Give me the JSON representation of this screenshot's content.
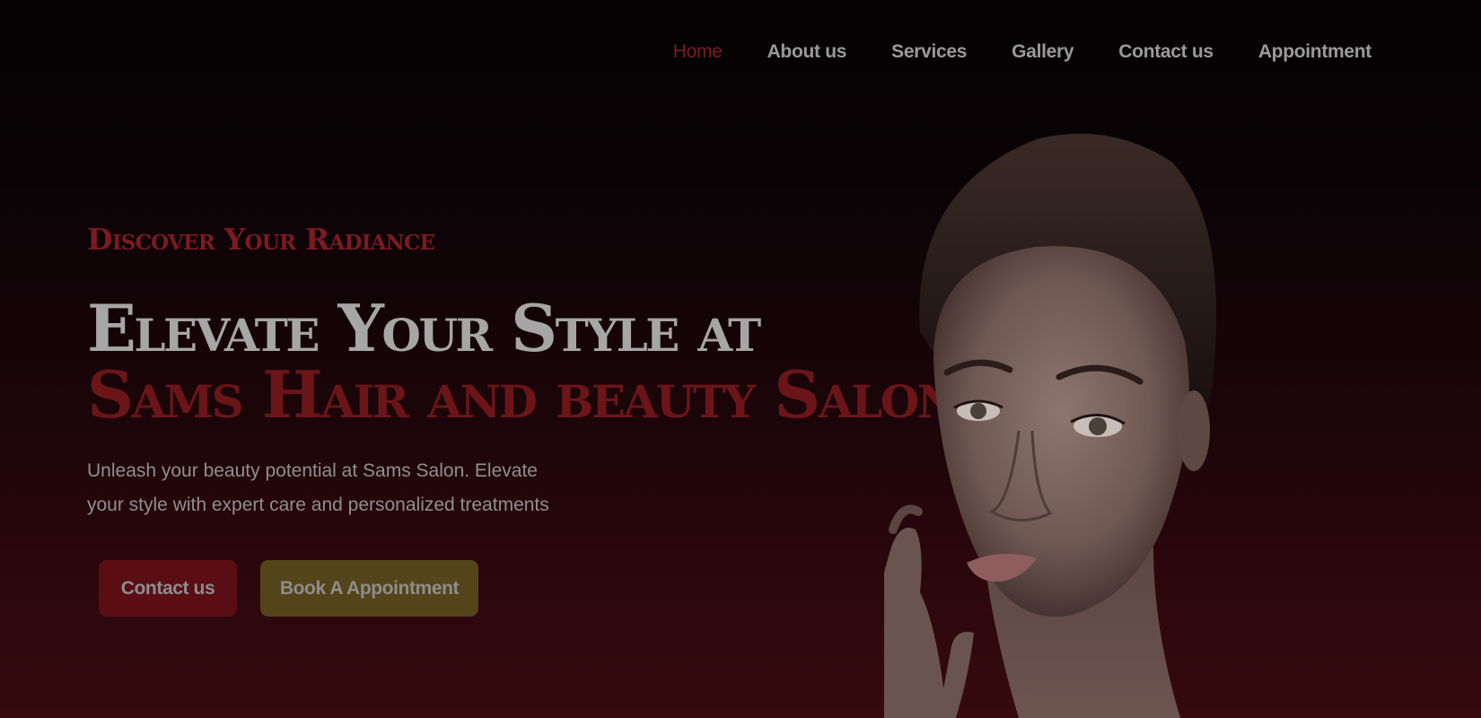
{
  "nav": {
    "items": [
      {
        "label": "Home",
        "active": true
      },
      {
        "label": "About us",
        "active": false
      },
      {
        "label": "Services",
        "active": false
      },
      {
        "label": "Gallery",
        "active": false
      },
      {
        "label": "Contact us",
        "active": false
      },
      {
        "label": "Appointment",
        "active": false
      }
    ]
  },
  "hero": {
    "eyebrow": "Discover Your Radiance",
    "title_line1": "Elevate Your Style at",
    "title_line2": "Sams Hair and beauty Salon",
    "description": "Unleash your beauty potential at Sams Salon. Elevate your style with expert care and personalized treatments",
    "contact_button": "Contact us",
    "book_button": "Book A Appointment"
  },
  "colors": {
    "accent_red": "#7c1a21",
    "button_red": "#5a0e14",
    "button_gold": "#544419",
    "text_gray": "#a6a6a6"
  },
  "icons": [
    "woman-portrait-image"
  ]
}
